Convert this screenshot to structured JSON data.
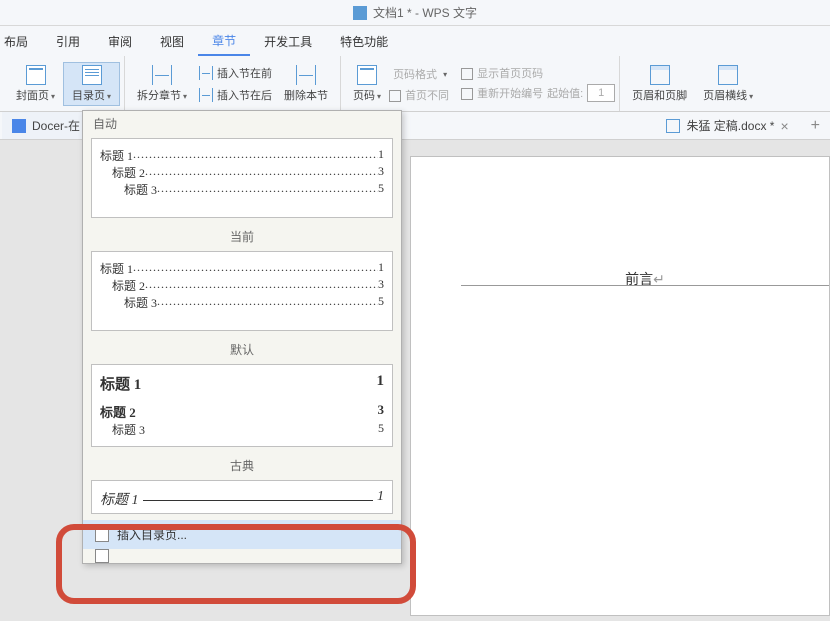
{
  "titlebar": {
    "text": "文档1 * - WPS 文字"
  },
  "menus": {
    "layout": "布局",
    "references": "引用",
    "review": "审阅",
    "view": "视图",
    "section": "章节",
    "devtools": "开发工具",
    "features": "特色功能"
  },
  "ribbon": {
    "cover": "封面页",
    "toc": "目录页",
    "split_section": "拆分章节",
    "insert_before": "插入节在前",
    "insert_after": "插入节在后",
    "delete_section": "删除本节",
    "page_number": "页码",
    "number_format": "页码格式",
    "first_page_different": "首页不同",
    "show_first_page_number": "显示首页页码",
    "restart_numbering": "重新开始编号",
    "start_value_label": "起始值:",
    "start_value": "1",
    "header_footer": "页眉和页脚",
    "header_line": "页眉横线"
  },
  "tabs": {
    "docer": "Docer-在",
    "file2": "朱猛 定稿.docx *"
  },
  "page": {
    "heading": "前言",
    "cursor": "↵"
  },
  "dropdown": {
    "auto_label": "自动",
    "current_label": "当前",
    "default_label": "默认",
    "classic_label": "古典",
    "h1": "标题 1",
    "h2": "标题 2",
    "h3": "标题 3",
    "p1": "1",
    "p3": "3",
    "p5": "5",
    "dots": "..................................................................",
    "underscores": "________________________________",
    "insert_toc": "插入目录页..."
  }
}
